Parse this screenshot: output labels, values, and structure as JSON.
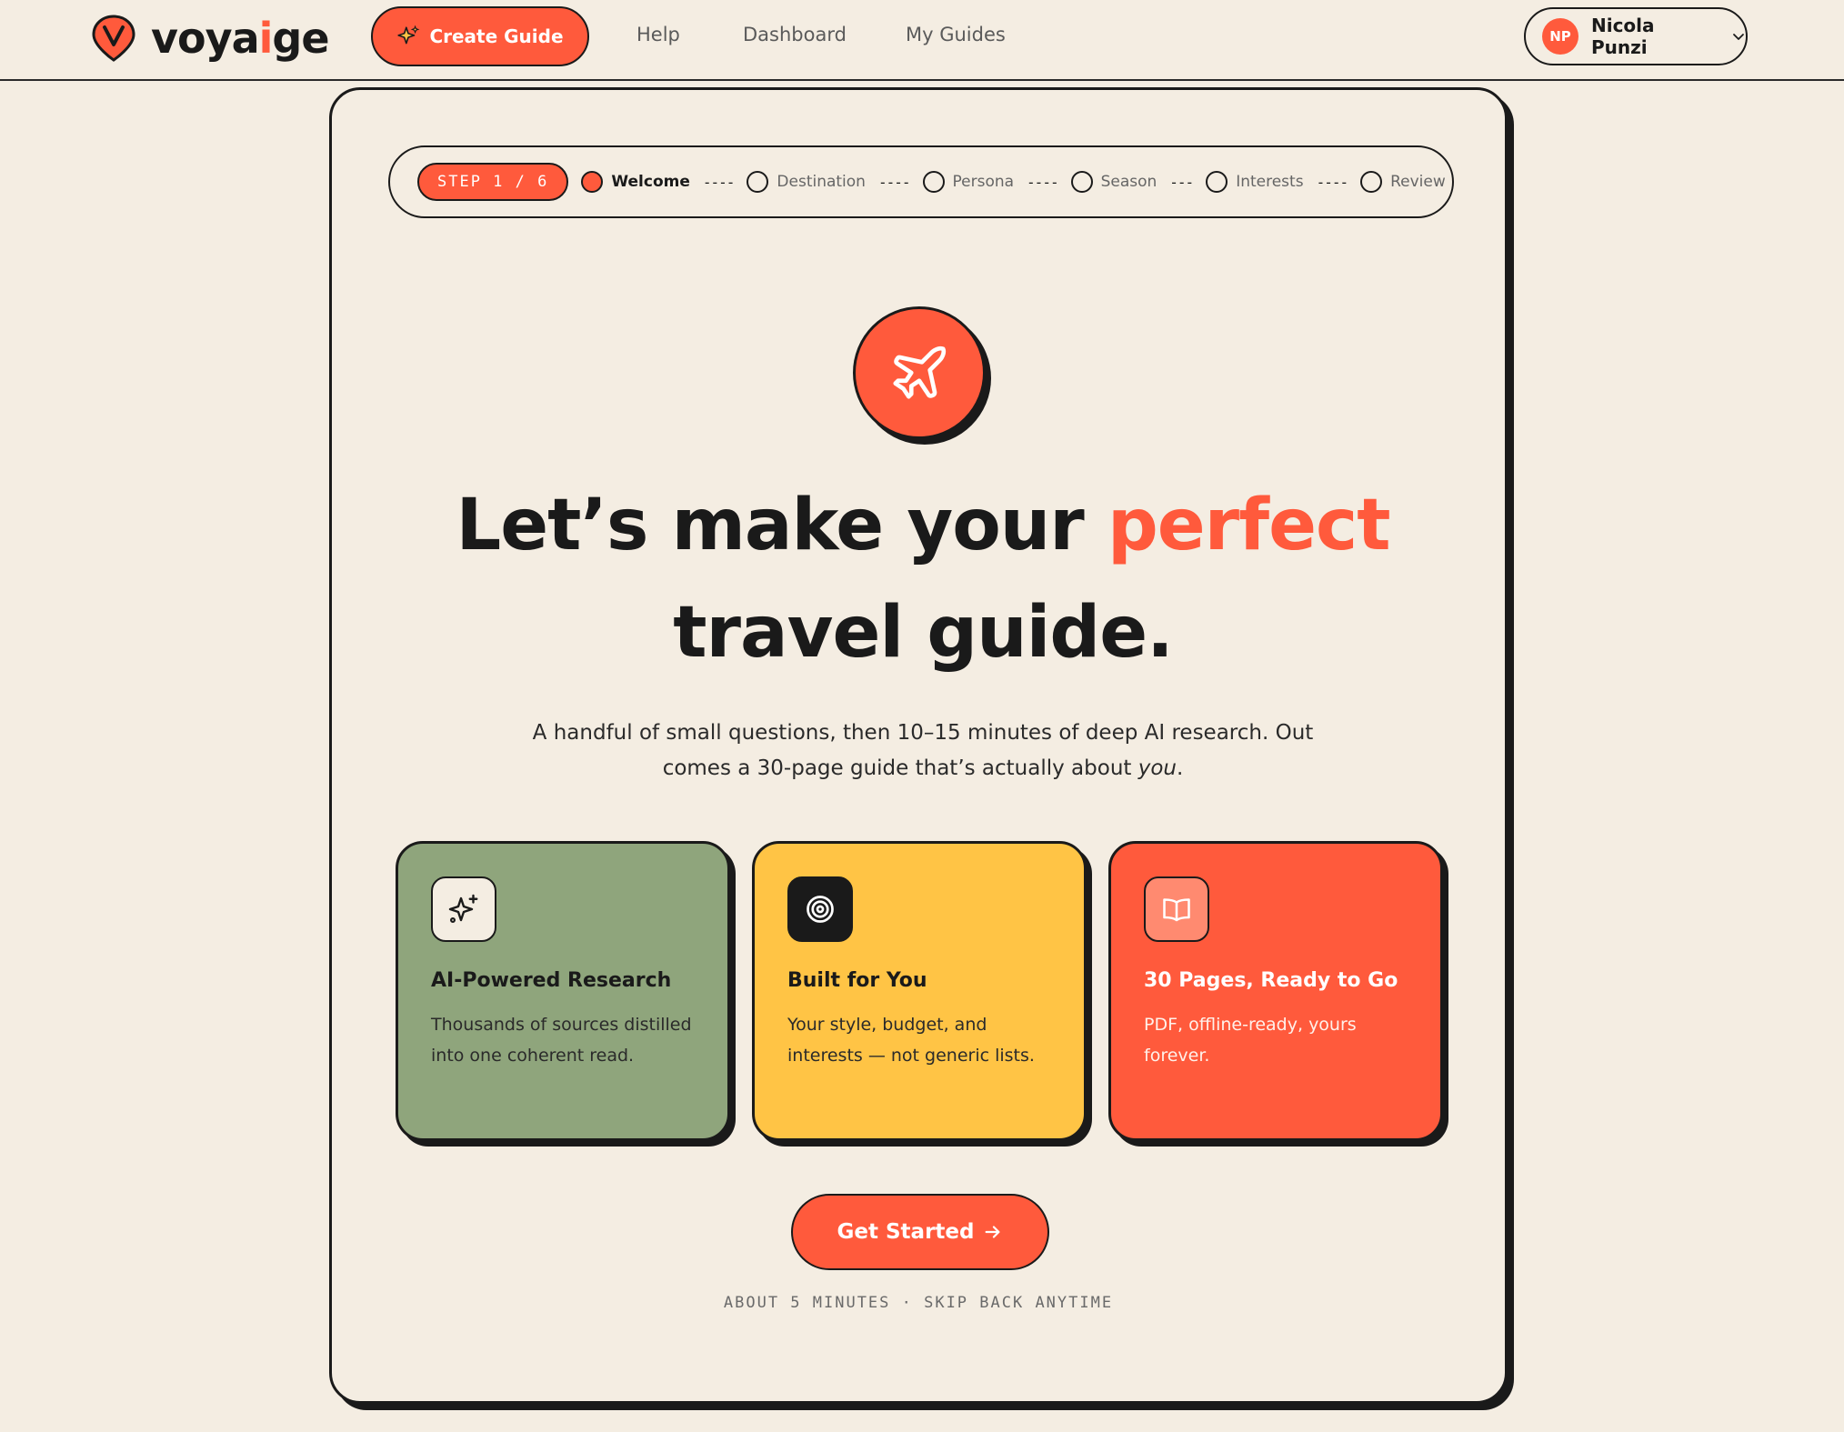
{
  "app": {
    "logo_prefix": "voya",
    "logo_ai": "i",
    "logo_suffix": "ge",
    "accent_color": "#ff5a3c"
  },
  "nav": {
    "create_label": "Create Guide",
    "links": [
      "Help",
      "Dashboard",
      "My Guides"
    ],
    "user_initials": "NP",
    "user_name": "Nicola Punzi"
  },
  "stepper": {
    "badge": "STEP 1 / 6",
    "steps": [
      {
        "label": "Welcome",
        "active": true
      },
      {
        "label": "Destination",
        "active": false
      },
      {
        "label": "Persona",
        "active": false
      },
      {
        "label": "Season",
        "active": false
      },
      {
        "label": "Interests",
        "active": false
      },
      {
        "label": "Review",
        "active": false
      }
    ],
    "separators": [
      "----",
      "----",
      "----",
      "---",
      "----"
    ]
  },
  "hero": {
    "icon": "plane-icon",
    "title_before": "Let’s make your ",
    "title_accent": "perfect",
    "title_after": " travel guide.",
    "subtitle_before": "A handful of small questions, then 10–15 minutes of deep AI research. Out comes a 30-page guide that’s actually about ",
    "subtitle_em": "you",
    "subtitle_after": "."
  },
  "features": [
    {
      "icon": "sparkle-icon",
      "title": "AI-Powered Research",
      "desc": "Thousands of sources distilled into one coherent read.",
      "bg": "#8fa57c"
    },
    {
      "icon": "target-icon",
      "title": "Built for You",
      "desc": "Your style, budget, and interests — not generic lists.",
      "bg": "#ffc445"
    },
    {
      "icon": "book-icon",
      "title": "30 Pages, Ready to Go",
      "desc": "PDF, offline-ready, yours forever.",
      "bg": "#ff5a3c"
    }
  ],
  "cta": {
    "label": "Get Started",
    "footnote": "ABOUT 5 MINUTES · SKIP BACK ANYTIME"
  }
}
